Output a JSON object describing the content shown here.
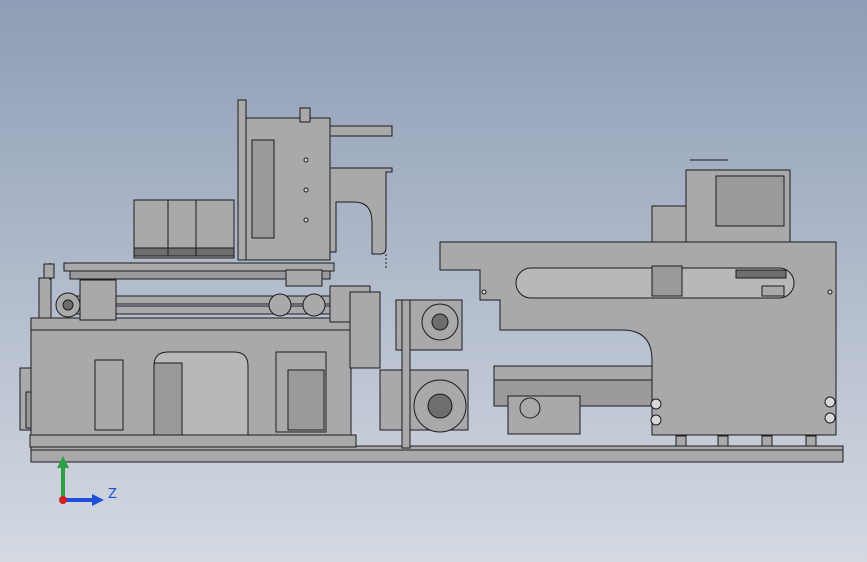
{
  "viewport": {
    "background_top": "#8e9db5",
    "background_bottom": "#d4d9e2"
  },
  "model": {
    "body_color": "#a9a9ab",
    "dark_color": "#6e6e70",
    "outline_color": "#1c1c1c"
  },
  "triad": {
    "z_label": "Z",
    "y_color": "#2ea043",
    "z_color": "#1f4fd8",
    "x_color": "#d21f1f"
  }
}
